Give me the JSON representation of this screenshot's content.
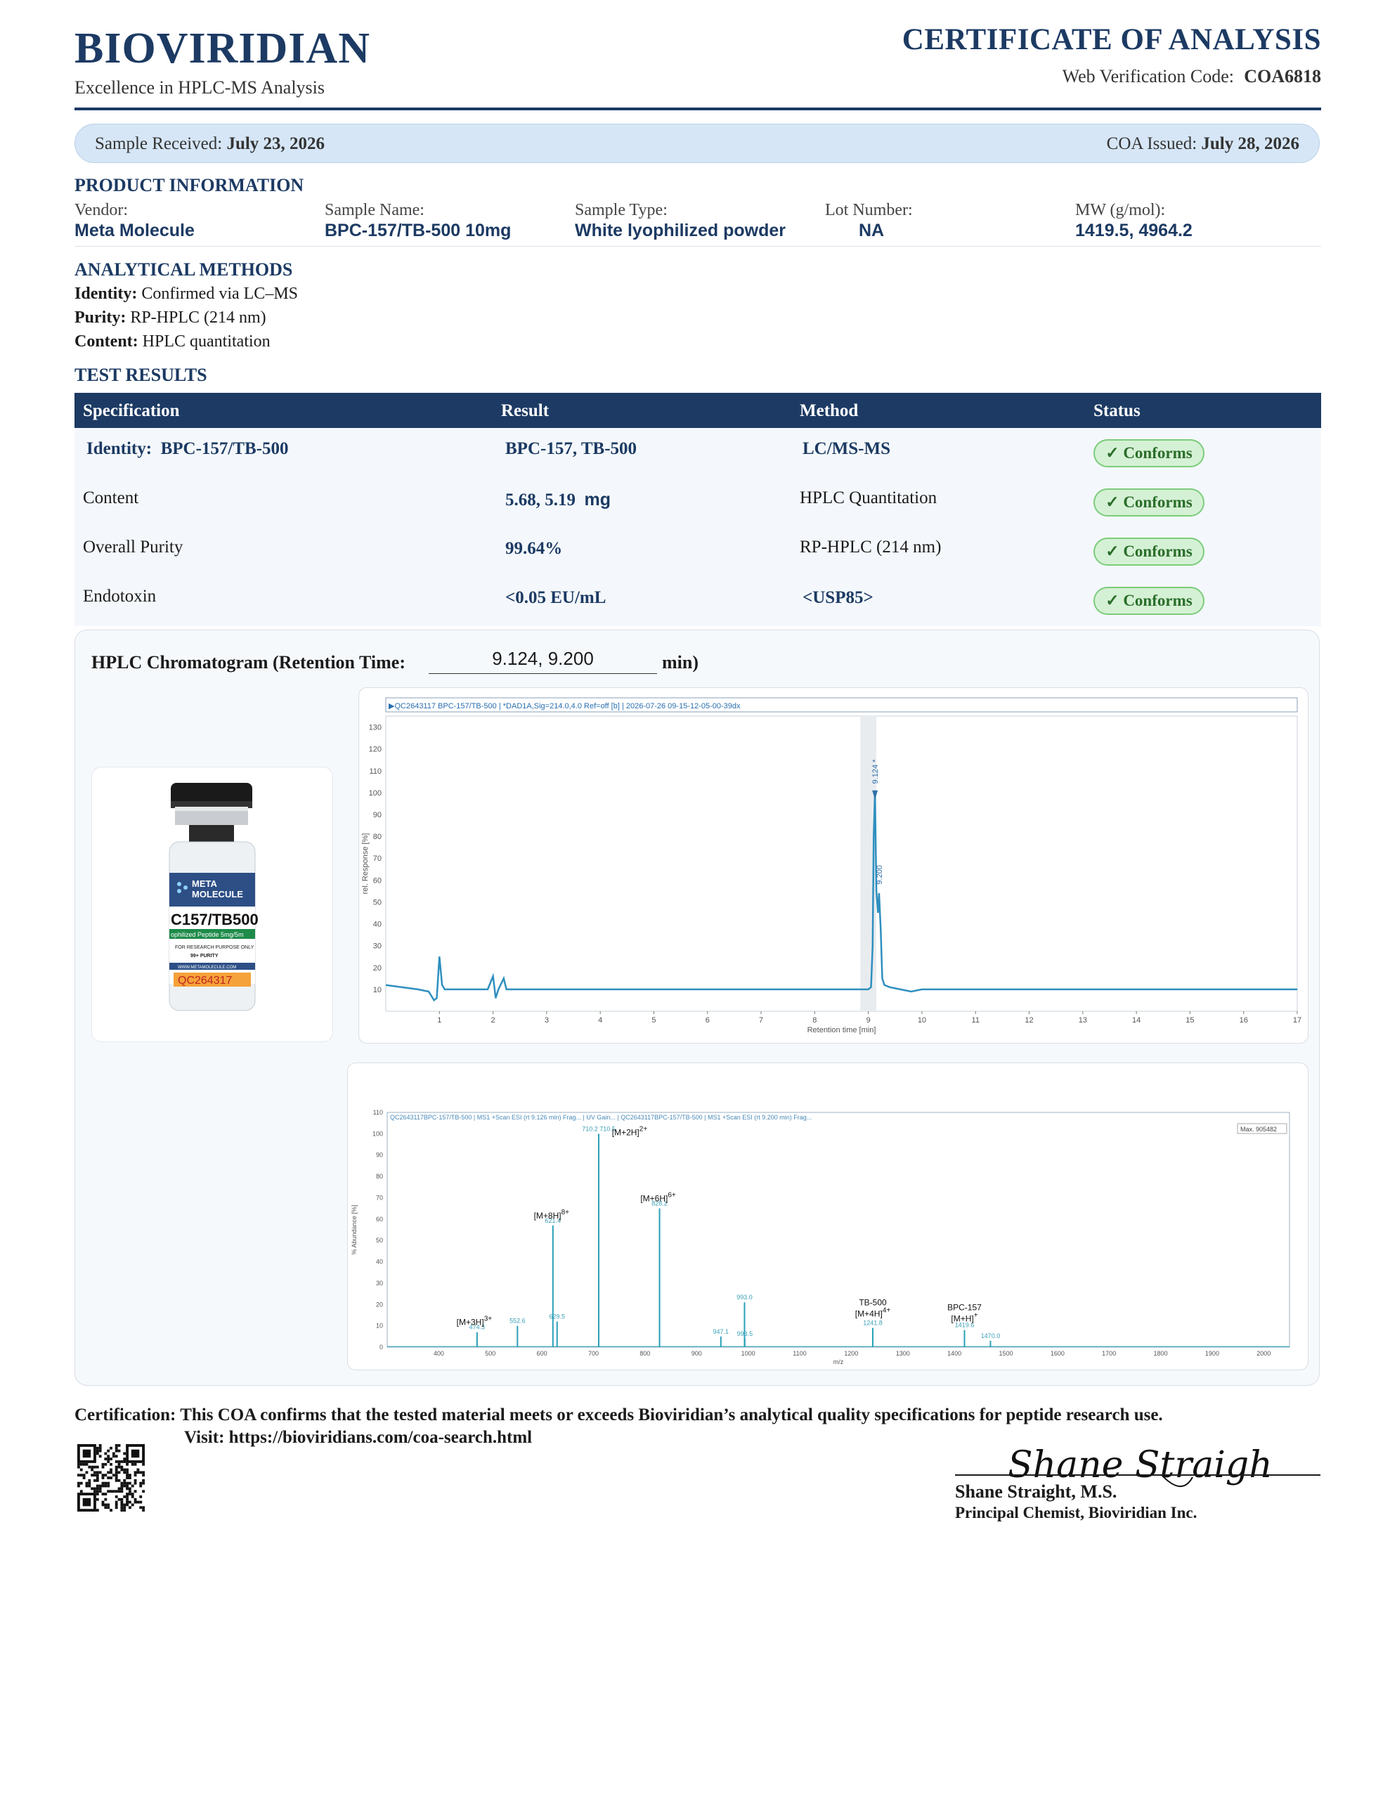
{
  "header": {
    "brand": "BIOVIRIDIAN",
    "tagline": "Excellence in HPLC-MS Analysis",
    "doc_title": "CERTIFICATE OF ANALYSIS",
    "verification_label": "Web Verification Code:",
    "verification_code": "COA6818"
  },
  "dates": {
    "received_label": "Sample Received:",
    "received_value": "July 23, 2026",
    "issued_label": "COA Issued:",
    "issued_value": "July 28, 2026"
  },
  "product_info": {
    "title": "PRODUCT INFORMATION",
    "fields": [
      {
        "label": "Vendor:",
        "value": "Meta Molecule"
      },
      {
        "label": "Sample Name:",
        "value": "BPC-157/TB-500 10mg"
      },
      {
        "label": "Sample Type:",
        "value": "White lyophilized powder"
      },
      {
        "label": "Lot Number:",
        "value": "NA"
      },
      {
        "label": "MW (g/mol):",
        "value": "1419.5, 4964.2"
      }
    ]
  },
  "methods": {
    "title": "ANALYTICAL METHODS",
    "lines": [
      {
        "label": "Identity:",
        "value": "Confirmed via LC–MS"
      },
      {
        "label": "Purity:",
        "value": "RP-HPLC (214 nm)"
      },
      {
        "label": "Content:",
        "value": "HPLC quantitation"
      }
    ]
  },
  "results": {
    "title": "TEST RESULTS",
    "headers": [
      "Specification",
      "Result",
      "Method",
      "Status"
    ],
    "rows": [
      {
        "spec_label": "Identity:",
        "spec_value": "BPC-157/TB-500",
        "result": "BPC-157, TB-500",
        "method": "LC/MS-MS",
        "status": "✓ Conforms"
      },
      {
        "spec_label": "",
        "spec_value": "Content",
        "result": "5.68, 5.19",
        "result_unit": "mg",
        "method": "HPLC Quantitation",
        "status": "✓ Conforms"
      },
      {
        "spec_label": "",
        "spec_value": "Overall Purity",
        "result": "99.64%",
        "method": "RP-HPLC (214 nm)",
        "status": "✓ Conforms"
      },
      {
        "spec_label": "",
        "spec_value": "Endotoxin",
        "result": "<0.05 EU/mL",
        "method": "<USP85>",
        "status": "✓ Conforms"
      }
    ]
  },
  "chromatogram": {
    "title": "HPLC Chromatogram (Retention Time:",
    "retention_time": "9.124, 9.200",
    "unit": "min)"
  },
  "vial": {
    "brand_line1": "META",
    "brand_line2": "MOLECULE",
    "product": "C157/TB500",
    "strip": "ophilized Peptide 5mg/5m",
    "purpose": "FOR RESEARCH PURPOSE ONLY",
    "purity": "99+ PURITY",
    "url": "WWW.METAMOLECULE.COM",
    "lot": "QC264317"
  },
  "chart_data": [
    {
      "type": "line",
      "title": "▶QC2643117 BPC-157/TB-500 | *DAD1A,Sig=214.0,4.0 Ref=off [b] | 2026-07-26 09-15-12-05-00-39dx",
      "xlabel": "Retention time [min]",
      "ylabel": "rel. Response [%]",
      "xlim": [
        0.0,
        17.0
      ],
      "ylim": [
        0,
        135
      ],
      "x_ticks": [
        1,
        2,
        3,
        4,
        5,
        6,
        7,
        8,
        9,
        10,
        11,
        12,
        13,
        14,
        15,
        16,
        17
      ],
      "y_ticks": [
        10,
        20,
        30,
        40,
        50,
        60,
        70,
        80,
        90,
        100,
        110,
        120,
        130
      ],
      "peak_labels": [
        "9.124 *",
        "9.200"
      ],
      "series": [
        {
          "x": [
            0.0,
            0.6,
            0.8,
            0.9,
            0.95,
            1.0,
            1.05,
            1.1,
            1.2,
            1.5,
            1.9,
            2.0,
            2.05,
            2.1,
            2.2,
            2.25,
            2.3,
            2.4,
            3.0,
            5.0,
            7.0,
            8.0,
            8.8,
            8.95,
            9.0,
            9.05,
            9.08,
            9.1,
            9.124,
            9.15,
            9.18,
            9.2,
            9.23,
            9.26,
            9.3,
            9.4,
            9.6,
            9.8,
            10.0,
            10.5,
            12.0,
            14.0,
            16.0,
            17.0
          ],
          "y": [
            12,
            10,
            9,
            5,
            6,
            25,
            12,
            10,
            10,
            10,
            10,
            16,
            6,
            10,
            15,
            10,
            10,
            10,
            10,
            10,
            10,
            10,
            10,
            10,
            10,
            11,
            30,
            80,
            100,
            55,
            45,
            54,
            38,
            15,
            12,
            11,
            10,
            9,
            10,
            10,
            10,
            10,
            10,
            10
          ]
        }
      ]
    },
    {
      "type": "bar",
      "title": "QC2643117BPC-157/TB-500 | MS1 +Scan ESI (rt 9.126 min) Frag... | UV Gain... | QC2643117BPC-157/TB-500 | MS1 +Scan ESI (rt 9.200 min) Frag...",
      "xlabel": "m/z",
      "ylabel": "% Abundance [%]",
      "xlim": [
        300,
        2050
      ],
      "ylim": [
        0,
        110
      ],
      "x_ticks": [
        400,
        500,
        600,
        700,
        800,
        900,
        1000,
        1100,
        1200,
        1300,
        1400,
        1500,
        1600,
        1700,
        1800,
        1900,
        2000
      ],
      "y_ticks": [
        0,
        10,
        20,
        30,
        40,
        50,
        60,
        70,
        80,
        90,
        100,
        110
      ],
      "max_label": "Max. 905482",
      "x": [
        474.3,
        552.6,
        621.4,
        629.5,
        710.2,
        828.2,
        947.1,
        993.0,
        993.5,
        1241.8,
        1419.6,
        1470.0
      ],
      "values": [
        7,
        10,
        57,
        12,
        100,
        65,
        5,
        21,
        4,
        9,
        8,
        3
      ],
      "point_labels": [
        "474.3",
        "552.6",
        "621.4",
        "629.5",
        "710.2 710.5",
        "828.2",
        "947.1",
        "993.0",
        "993.5",
        "1241.8",
        "1419.6",
        "1470.0"
      ],
      "annotations": [
        {
          "text": "[M+2H]",
          "sup": "2+",
          "x": 710.2
        },
        {
          "text": "[M+6H]",
          "sup": "6+",
          "x": 828.2
        },
        {
          "text": "[M+8H]",
          "sup": "8+",
          "x": 621.4
        },
        {
          "text": "[M+3H]",
          "sup": "3+",
          "x": 474.3
        },
        {
          "text": "TB-500",
          "sup": "",
          "x": 1241.8
        },
        {
          "text": "[M+4H]",
          "sup": "4+",
          "x": 1241.8
        },
        {
          "text": "BPC-157",
          "sup": "",
          "x": 1419.6
        },
        {
          "text": "[M+H]",
          "sup": "+",
          "x": 1419.6
        }
      ]
    }
  ],
  "certification": {
    "label": "Certification:",
    "text": "This COA confirms that the tested material meets or exceeds Bioviridian’s analytical quality specifications for peptide research use.",
    "visit": "Visit: https://bioviridians.com/coa-search.html"
  },
  "signature": {
    "script": "Shane Straight",
    "name": "Shane Straight, M.S.",
    "title": "Principal Chemist, Bioviridian Inc."
  },
  "colors": {
    "navy": "#1c3a63",
    "chart_line": "#2e8fbf",
    "ms_line": "#2aa0b8",
    "badge_bg": "#d5f1d5",
    "date_bar": "#d6e6f6"
  }
}
